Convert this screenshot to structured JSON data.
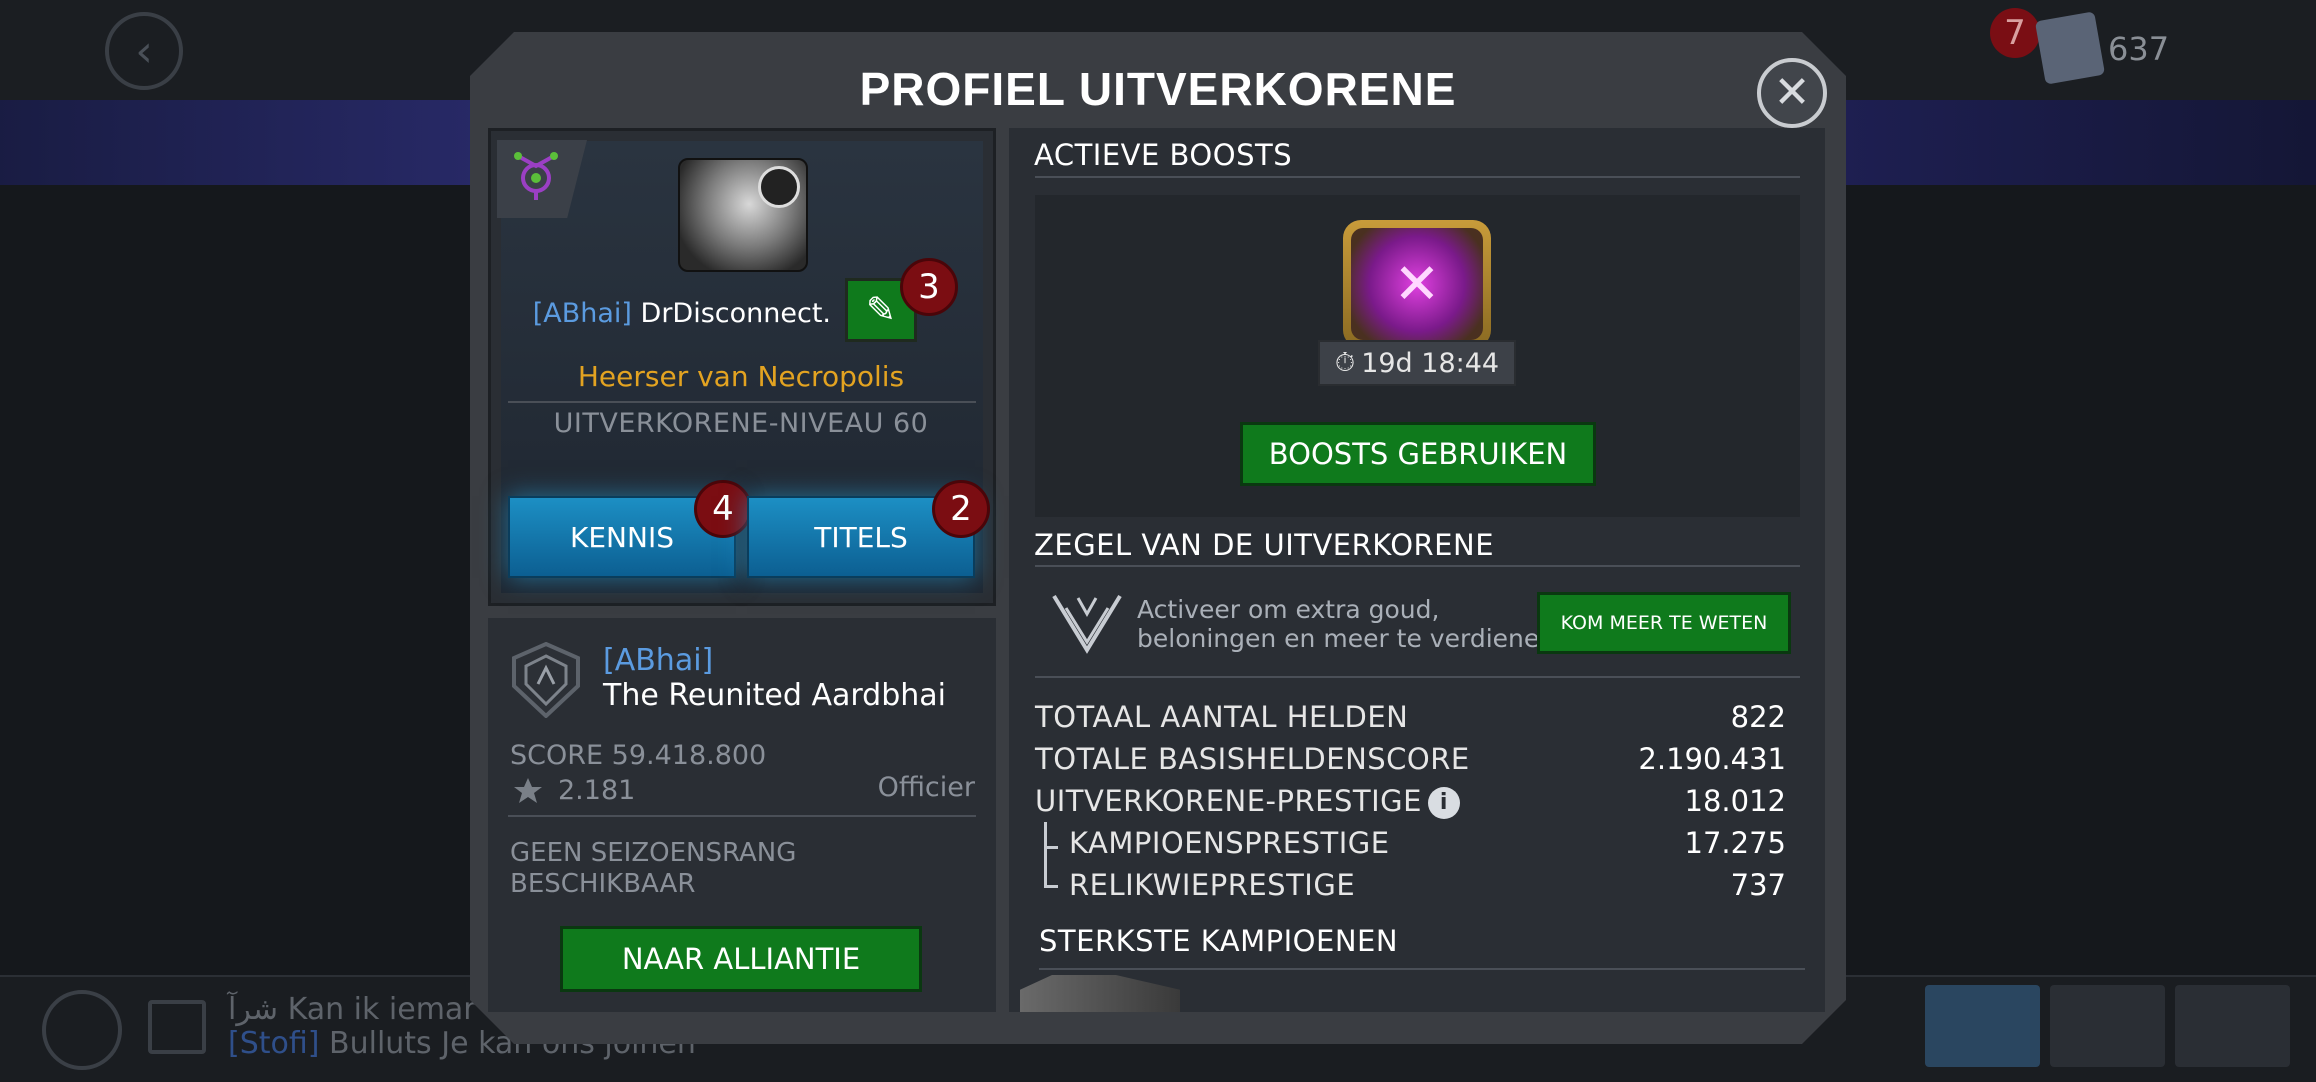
{
  "background": {
    "notification_count": "7",
    "units_count": "637",
    "chat": {
      "line1_user": "شرآ",
      "line1_text": "Kan ik iemar",
      "line2_tag": "[Stofi]",
      "line2_user": "Bulluts",
      "line2_text": "Je kan ons joinen"
    }
  },
  "modal": {
    "title": "PROFIEL UITVERKORENE",
    "close_glyph": "✕"
  },
  "profile": {
    "alliance_tag": "[ABhai]",
    "name": "DrDisconnect.",
    "edit_badge": "3",
    "title": "Heerser van Necropolis",
    "level": "UITVERKORENE-NIVEAU 60",
    "knowledge_label": "KENNIS",
    "knowledge_badge": "4",
    "titles_label": "TITELS",
    "titles_badge": "2"
  },
  "alliance": {
    "tag": "[ABhai]",
    "name": "The Reunited Aardbhai",
    "score": "SCORE 59.418.800",
    "rating": "2.181",
    "role": "Officier",
    "season_rank": "GEEN SEIZOENSRANG BESCHIKBAAR",
    "go_button": "NAAR ALLIANTIE"
  },
  "boosts": {
    "header": "ACTIEVE BOOSTS",
    "timer": "19d 18:44",
    "use_button": "BOOSTS GEBRUIKEN"
  },
  "seal": {
    "header": "ZEGEL VAN DE UITVERKORENE",
    "text_line1": "Activeer om extra goud,",
    "text_line2": "beloningen en meer te verdienen!",
    "learn_button": "KOM MEER TE WETEN"
  },
  "stats": {
    "total_heroes_label": "TOTAAL AANTAL HELDEN",
    "total_heroes_value": "822",
    "base_score_label": "TOTALE BASISHELDENSCORE",
    "base_score_value": "2.190.431",
    "prestige_label": "UITVERKORENE-PRESTIGE",
    "prestige_value": "18.012",
    "champion_prestige_label": "KAMPIOENSPRESTIGE",
    "champion_prestige_value": "17.275",
    "relic_prestige_label": "RELIKWIEPRESTIGE",
    "relic_prestige_value": "737"
  },
  "strongest": {
    "header": "STERKSTE KAMPIOENEN"
  },
  "colors": {
    "accent_green": "#0f7a1c",
    "accent_blue": "#1c8fc4",
    "badge_red": "#7b0d12",
    "title_gold": "#e3a321",
    "tag_blue": "#5b9be0"
  },
  "icons": [
    "back-arrow-icon",
    "close-icon",
    "class-icon",
    "edit-pencil-icon",
    "alliance-shield-icon",
    "rating-star-icon",
    "stopwatch-icon",
    "info-icon",
    "seal-chevron-icon"
  ]
}
